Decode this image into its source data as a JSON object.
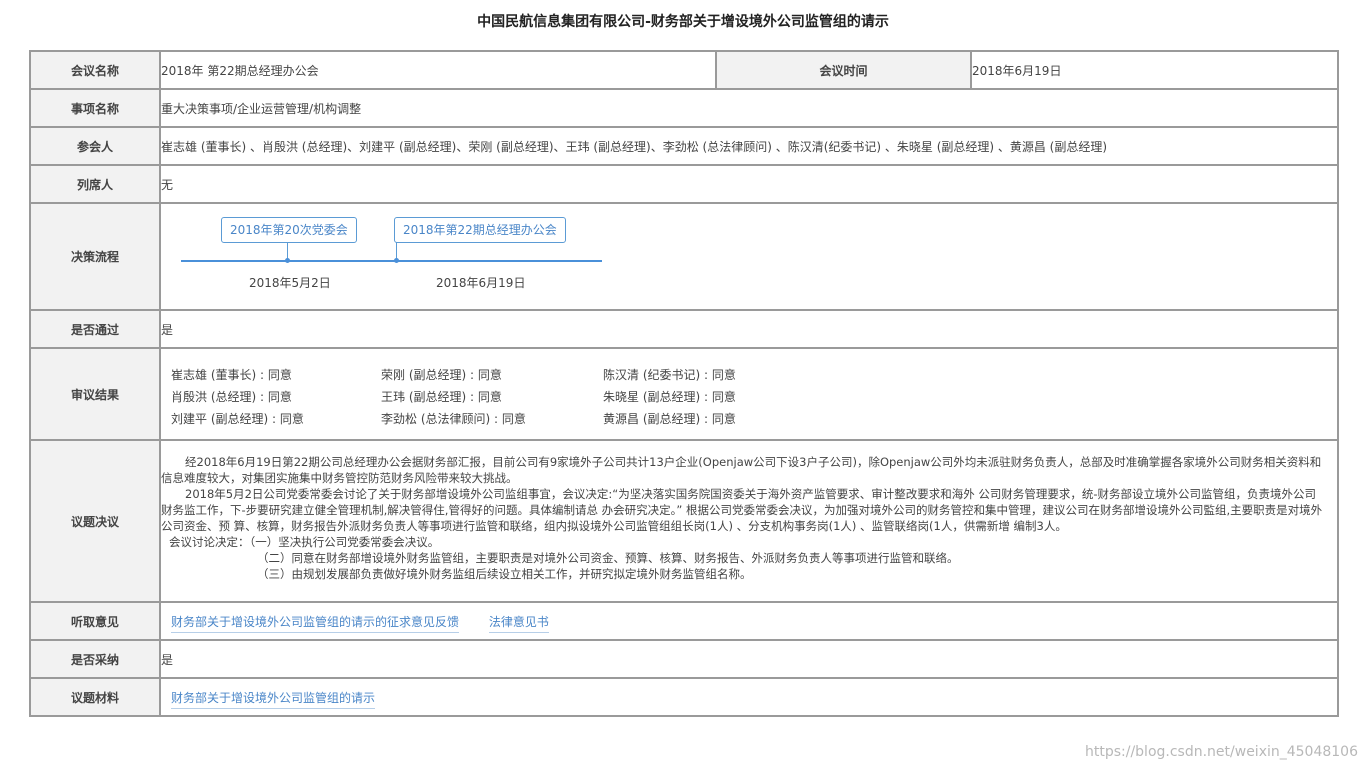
{
  "title": "中国民航信息集团有限公司-财务部关于增设境外公司监管组的请示",
  "meeting": {
    "name_label": "会议名称",
    "name_value": "2018年 第22期总经理办公会",
    "time_label": "会议时间",
    "time_value": "2018年6月19日"
  },
  "item": {
    "label": "事项名称",
    "value": "重大决策事项/企业运营管理/机构调整"
  },
  "attendees": {
    "label": "参会人",
    "value": "崔志雄 (董事长) 、肖殷洪 (总经理)、刘建平 (副总经理)、荣刚 (副总经理)、王玮 (副总经理)、李劲松 (总法律顾问) 、陈汉清(纪委书记) 、朱晓星 (副总经理) 、黄源昌 (副总经理)"
  },
  "observers": {
    "label": "列席人",
    "value": "无"
  },
  "process": {
    "label": "决策流程",
    "steps": [
      {
        "name": "2018年第20次党委会",
        "date": "2018年5月2日"
      },
      {
        "name": "2018年第22期总经理办公会",
        "date": "2018年6月19日"
      }
    ]
  },
  "passed": {
    "label": "是否通过",
    "value": "是"
  },
  "review": {
    "label": "审议结果",
    "votes": [
      "崔志雄 (董事长) : 同意",
      "荣刚 (副总经理) : 同意",
      "陈汉清 (纪委书记) : 同意",
      "肖殷洪 (总经理) : 同意",
      "王玮 (副总经理) : 同意",
      "朱晓星 (副总经理) : 同意",
      "刘建平 (副总经理) : 同意",
      "李劲松 (总法律顾问) : 同意",
      "黄源昌 (副总经理) : 同意"
    ]
  },
  "resolution": {
    "label": "议题决议",
    "paragraphs": [
      "经2018年6月19日第22期公司总经理办公会据财务部汇报，目前公司有9家境外子公司共计13户企业(Openjaw公司下设3户子公司)，除Openjaw公司外均未派驻财务负责人，总部及时准确掌握各家境外公司财务相关资料和信息难度较大，对集团实施集中财务管控防范财务风险带来较大挑战。",
      "2018年5月2日公司党委常委会讨论了关于财务部增设境外公司监组事宜，会议决定:“为坚决落实国务院国资委关于海外资产监管要求、审计整改要求和海外 公司财务管理要求，统-财务部设立境外公司监管组，负责境外公司财务监工作，下-步要研究建立健全管理机制,解决管得住,管得好的问题。具体编制请总 办会研究决定。” 根据公司党委常委会决议，为加强对境外公司的财务管控和集中管理，建议公司在财务部增设境外公司監组,主要职责是对境外公司资金、预 算、核算，财务报告外派财务负责人等事项进行监管和联络，组内拟设境外公司监管组组长岗(1人) 、分支机构事务岗(1人) 、监管联络岗(1人，供需新增 编制3人。"
    ],
    "lead": "会议讨论决定：（一）坚决执行公司党委常委会决议。",
    "items": [
      "（二）同意在财务部增设境外财务监管组，主要职责是对境外公司资金、预算、核算、财务报告、外派财务负责人等事项进行监管和联络。",
      "（三）由规划发展部负责做好境外财务监组后续设立相关工作，并研究拟定境外财务监管组名称。"
    ]
  },
  "opinions": {
    "label": "听取意见",
    "links": [
      "财务部关于增设境外公司监管组的请示的征求意见反馈",
      "法律意见书"
    ]
  },
  "adopted": {
    "label": "是否采纳",
    "value": "是"
  },
  "materials": {
    "label": "议题材料",
    "links": [
      "财务部关于增设境外公司监管组的请示"
    ]
  },
  "watermark": "https://blog.csdn.net/weixin_45048106"
}
